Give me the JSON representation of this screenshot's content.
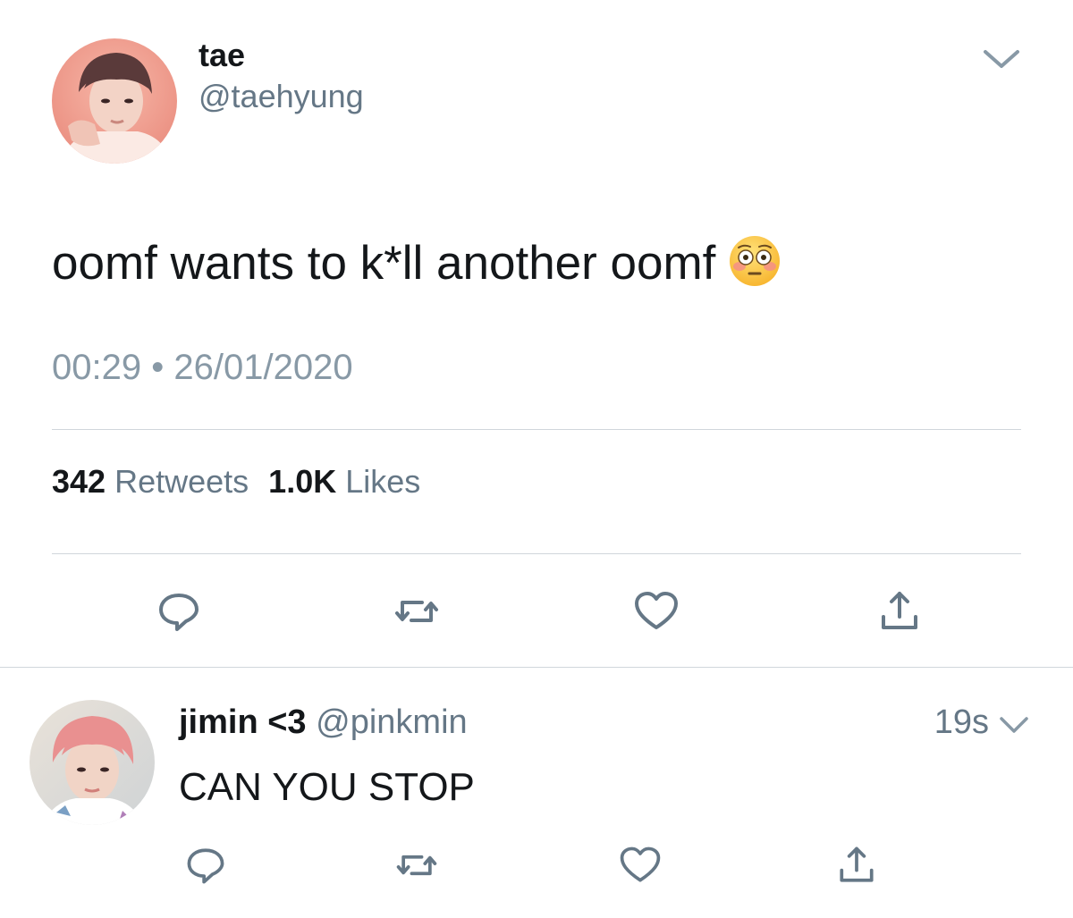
{
  "tweet": {
    "author_name": "tae",
    "author_handle": "@taehyung",
    "text": "oomf wants to k*ll another oomf",
    "emoji": "flushed-face-emoji",
    "time": "00:29",
    "separator": "•",
    "date": "26/01/2020",
    "retweet_count": "342",
    "retweet_label": "Retweets",
    "like_count": "1.0K",
    "like_label": "Likes",
    "icons": [
      "reply-icon",
      "retweet-icon",
      "like-icon",
      "share-icon",
      "chevron-down-icon"
    ]
  },
  "reply": {
    "author_name": "jimin <3",
    "author_handle": "@pinkmin",
    "time_ago": "19s",
    "text": "CAN YOU STOP",
    "icons": [
      "reply-icon",
      "retweet-icon",
      "like-icon",
      "share-icon",
      "chevron-down-icon"
    ]
  },
  "colors": {
    "text_primary": "#14171a",
    "text_secondary": "#657786",
    "timestamp": "#8899a6",
    "icon": "#657786",
    "divider": "#d0d6db"
  }
}
